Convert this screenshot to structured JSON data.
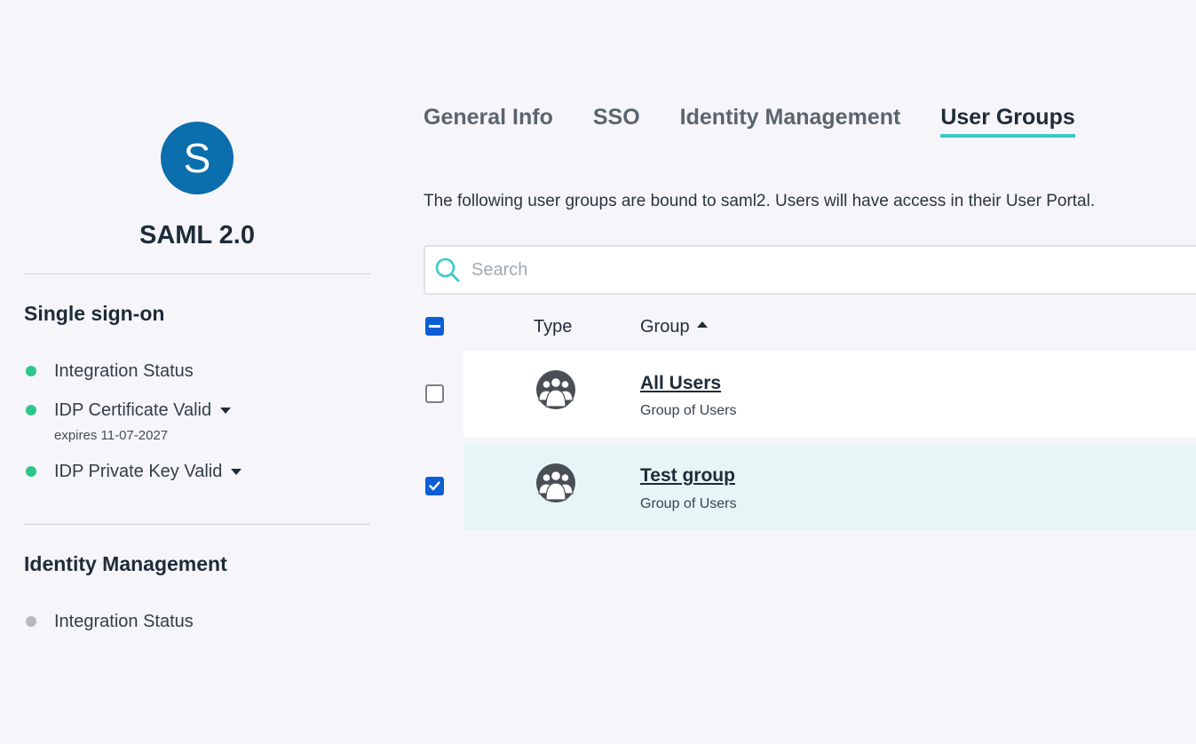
{
  "app": {
    "avatar_letter": "S",
    "name": "SAML 2.0"
  },
  "sidebar": {
    "sso_section": {
      "heading": "Single sign-on",
      "items": [
        {
          "label": "Integration Status",
          "status": "green"
        },
        {
          "label": "IDP Certificate Valid",
          "status": "green",
          "note": "expires 11-07-2027",
          "has_dropdown": true
        },
        {
          "label": "IDP Private Key Valid",
          "status": "green",
          "has_dropdown": true
        }
      ]
    },
    "idm_section": {
      "heading": "Identity Management",
      "items": [
        {
          "label": "Integration Status",
          "status": "gray"
        }
      ]
    }
  },
  "tabs": [
    {
      "label": "General Info",
      "active": false
    },
    {
      "label": "SSO",
      "active": false
    },
    {
      "label": "Identity Management",
      "active": false
    },
    {
      "label": "User Groups",
      "active": true
    }
  ],
  "description": "The following user groups are bound to saml2. Users will have access in their User Portal.",
  "search": {
    "placeholder": "Search",
    "value": ""
  },
  "table": {
    "select_all_state": "partial",
    "columns": {
      "type": "Type",
      "group": "Group",
      "group_sort": "ascending"
    },
    "rows": [
      {
        "name": "All Users",
        "description": "Group of Users",
        "icon": "user-group-icon",
        "checked": false
      },
      {
        "name": "Test group",
        "description": "Group of Users",
        "icon": "user-group-icon",
        "checked": true
      }
    ]
  },
  "colors": {
    "accent": "#3bc9c4",
    "avatar": "#0b6ead",
    "status_green": "#2cc68d",
    "status_gray": "#b8b8b8",
    "checkbox_blue": "#0b5fd6",
    "selected_row": "#e6f6f6"
  }
}
